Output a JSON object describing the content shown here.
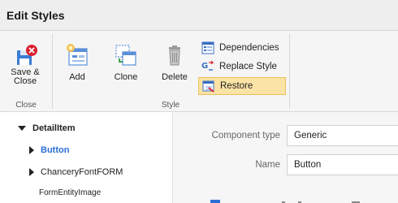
{
  "window": {
    "title": "Edit Styles"
  },
  "ribbon": {
    "groups": [
      {
        "label": "Close"
      },
      {
        "label": "Style"
      }
    ],
    "save_close": {
      "line1": "Save &",
      "line2": "Close",
      "icon": "save-icon"
    },
    "add": {
      "label": "Add",
      "icon": "add-style-icon"
    },
    "clone": {
      "label": "Clone",
      "icon": "clone-icon"
    },
    "delete": {
      "label": "Delete",
      "icon": "trash-icon"
    },
    "dependencies": {
      "label": "Dependencies",
      "icon": "dependencies-icon"
    },
    "replace_style": {
      "label": "Replace Style",
      "icon": "replace-icon"
    },
    "restore": {
      "label": "Restore",
      "icon": "restore-icon",
      "state": "highlighted"
    }
  },
  "tree": {
    "root": {
      "label": "DetailItem",
      "expanded": true
    },
    "children": [
      {
        "label": "Button",
        "expanded": false,
        "selected": true
      },
      {
        "label": "ChanceryFontFORM",
        "expanded": false
      },
      {
        "label": "FormEntityImage"
      }
    ]
  },
  "form": {
    "component_type": {
      "label": "Component type",
      "value": "Generic"
    },
    "name": {
      "label": "Name",
      "value": "Button"
    }
  },
  "colors": {
    "accent": "#2a6fd6",
    "highlight": "#fbe3a5",
    "close_badge": "#d9232e"
  }
}
